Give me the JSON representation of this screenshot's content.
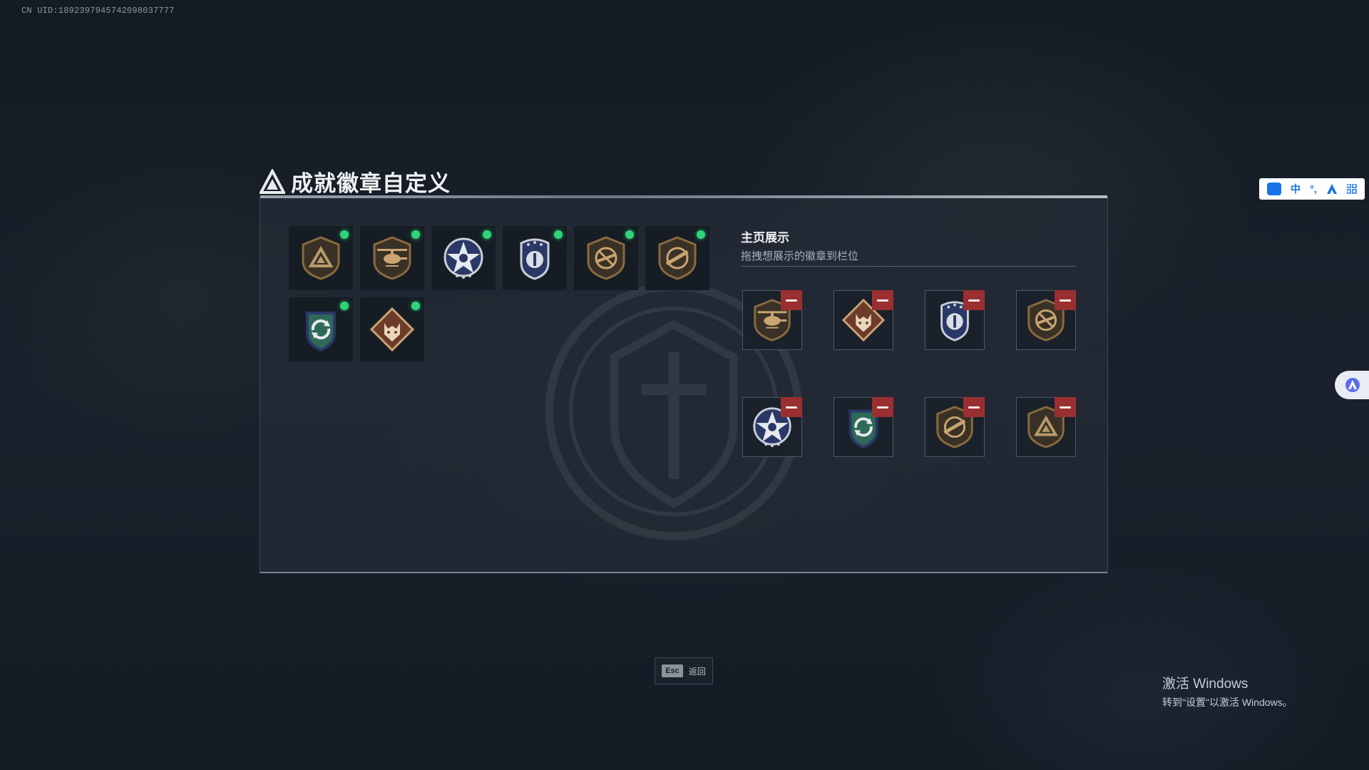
{
  "account": {
    "uid": "CN UID:1892397945742098037777"
  },
  "page": {
    "title": "成就徽章自定义"
  },
  "owned_badges": [
    {
      "icon": "triangle-shield-badge-icon",
      "is_new": true
    },
    {
      "icon": "helicopter-badge-icon",
      "is_new": true
    },
    {
      "icon": "star-emblem-badge-icon",
      "is_new": true
    },
    {
      "icon": "police-shield-badge-icon",
      "is_new": true
    },
    {
      "icon": "no-rifle-badge-icon",
      "is_new": true
    },
    {
      "icon": "rifle-shield-badge-icon",
      "is_new": true
    },
    {
      "icon": "recycle-shield-badge-icon",
      "is_new": true
    },
    {
      "icon": "wolf-diamond-badge-icon",
      "is_new": true
    }
  ],
  "showcase": {
    "title": "主页展示",
    "subtitle": "拖拽想展示的徽章到栏位",
    "slots": [
      {
        "icon": "helicopter-badge-icon"
      },
      {
        "icon": "wolf-diamond-badge-icon"
      },
      {
        "icon": "police-shield-badge-icon"
      },
      {
        "icon": "no-rifle-badge-icon"
      },
      {
        "icon": "star-emblem-badge-icon"
      },
      {
        "icon": "recycle-shield-badge-icon"
      },
      {
        "icon": "rifle-shield-badge-icon"
      },
      {
        "icon": "triangle-shield-badge-icon"
      }
    ]
  },
  "footer": {
    "esc_key": "Esc",
    "esc_label": "返回"
  },
  "ime_toolbar": {
    "lang": "中",
    "punct": "°,",
    "paw": "du"
  },
  "windows_watermark": {
    "line1": "激活 Windows",
    "line2": "转到\"设置\"以激活 Windows。"
  },
  "colors": {
    "new_dot": "#2fd37a",
    "remove_button": "#9a2f31",
    "bronze": "#8a6a3e",
    "navy": "#2a3868"
  }
}
